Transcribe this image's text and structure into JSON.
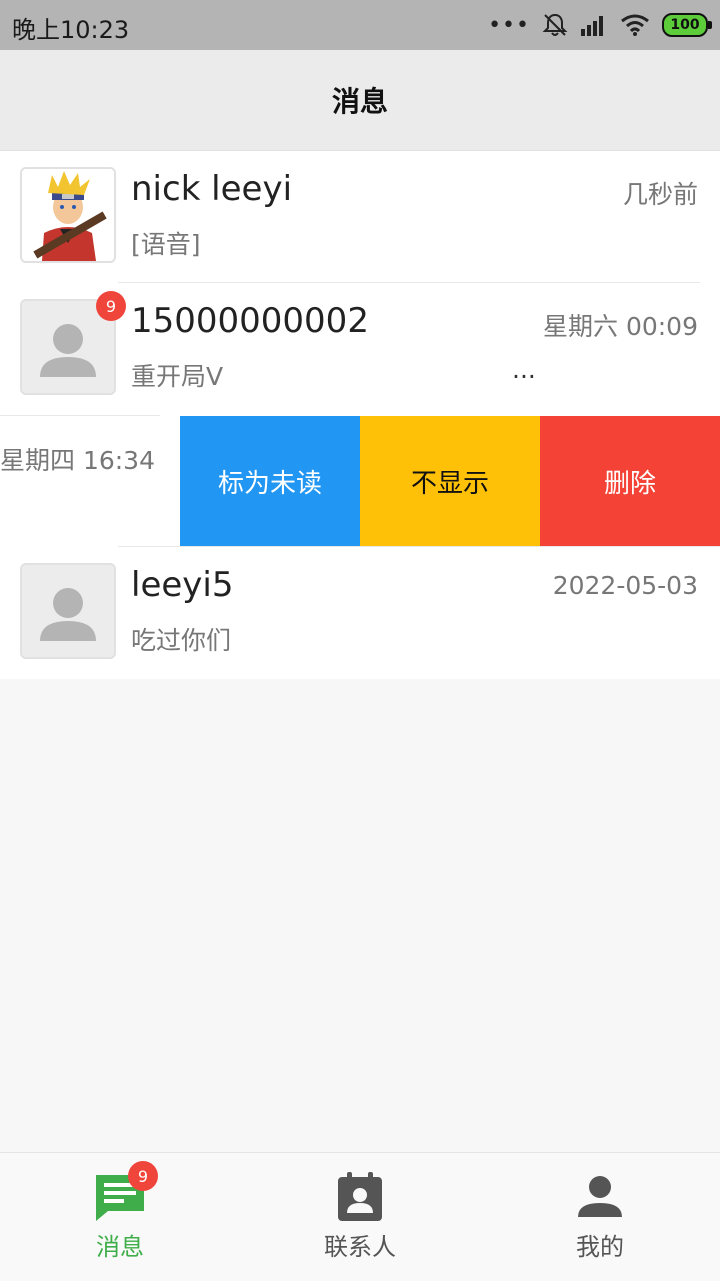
{
  "status_bar": {
    "time": "晚上10:23",
    "battery": "100"
  },
  "header": {
    "title": "消息"
  },
  "conversations": [
    {
      "name": "nick leeyi",
      "preview": "[语音]",
      "time": "几秒前",
      "badge": ""
    },
    {
      "name": "15000000002",
      "preview": "重开局V",
      "time": "星期六 00:09",
      "badge": "9",
      "overflow": "..."
    },
    {
      "time": "星期四 16:34"
    },
    {
      "name": "leeyi5",
      "preview": "吃过你们",
      "time": "2022-05-03",
      "badge": ""
    }
  ],
  "swipe_actions": [
    {
      "label": "标为未读",
      "color": "#2196f3",
      "text_color": "#ffffff"
    },
    {
      "label": "不显示",
      "color": "#ffc107",
      "text_color": "#111111"
    },
    {
      "label": "删除",
      "color": "#f44336",
      "text_color": "#ffffff"
    }
  ],
  "tabs": [
    {
      "label": "消息",
      "icon": "chat-icon",
      "badge": "9",
      "active": true
    },
    {
      "label": "联系人",
      "icon": "contacts-icon",
      "active": false
    },
    {
      "label": "我的",
      "icon": "person-icon",
      "active": false
    }
  ],
  "colors": {
    "accent": "#3fae4a",
    "badge": "#f0453a"
  }
}
